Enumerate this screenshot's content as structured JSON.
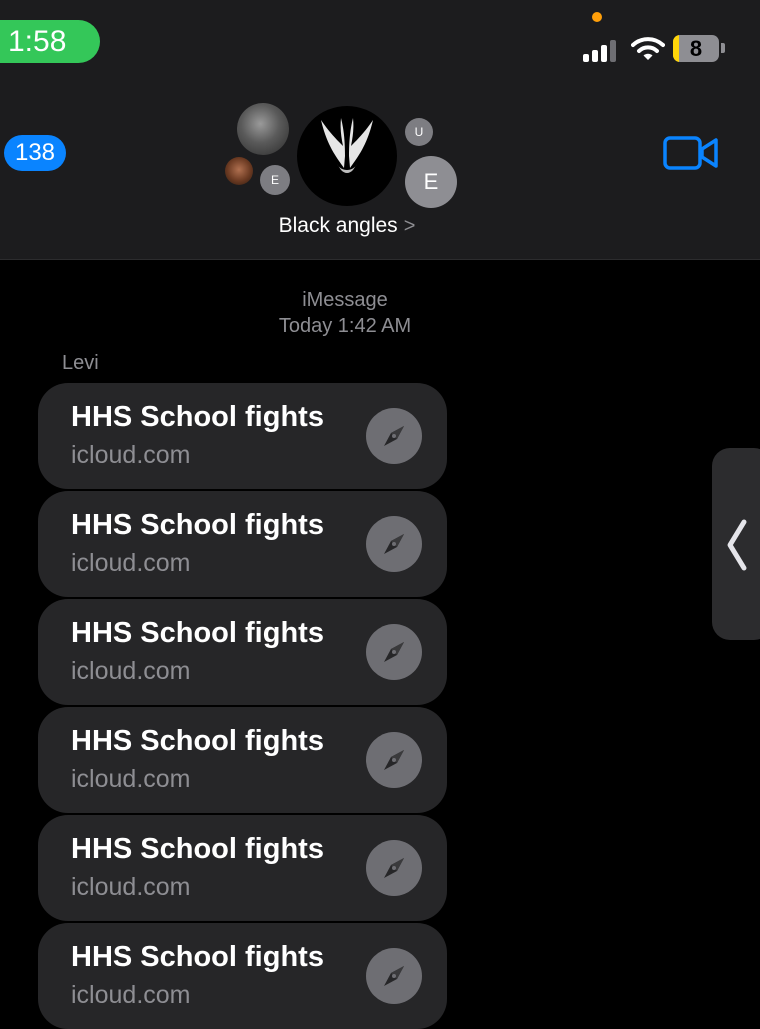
{
  "status_bar": {
    "time": "1:58",
    "battery_level": "8"
  },
  "nav": {
    "back_count": "138",
    "group_name": "Black angles",
    "group_chevron": ">",
    "avatars": {
      "small_left_initial": "E",
      "top_right_initial": "U",
      "big_right_initial": "E"
    }
  },
  "thread": {
    "service": "iMessage",
    "timestamp": "Today 1:42 AM",
    "sender": "Levi",
    "messages": [
      {
        "title": "HHS School fights",
        "domain": "icloud.com"
      },
      {
        "title": "HHS School fights",
        "domain": "icloud.com"
      },
      {
        "title": "HHS School fights",
        "domain": "icloud.com"
      },
      {
        "title": "HHS School fights",
        "domain": "icloud.com"
      },
      {
        "title": "HHS School fights",
        "domain": "icloud.com"
      },
      {
        "title": "HHS School fights",
        "domain": "icloud.com"
      }
    ]
  },
  "colors": {
    "accent": "#0a84ff",
    "time_pill": "#34c759",
    "bubble": "#262628"
  },
  "icons": [
    "cellular-signal-icon",
    "wifi-icon",
    "battery-icon",
    "video-call-icon",
    "compass-icon",
    "chevron-left-icon"
  ]
}
